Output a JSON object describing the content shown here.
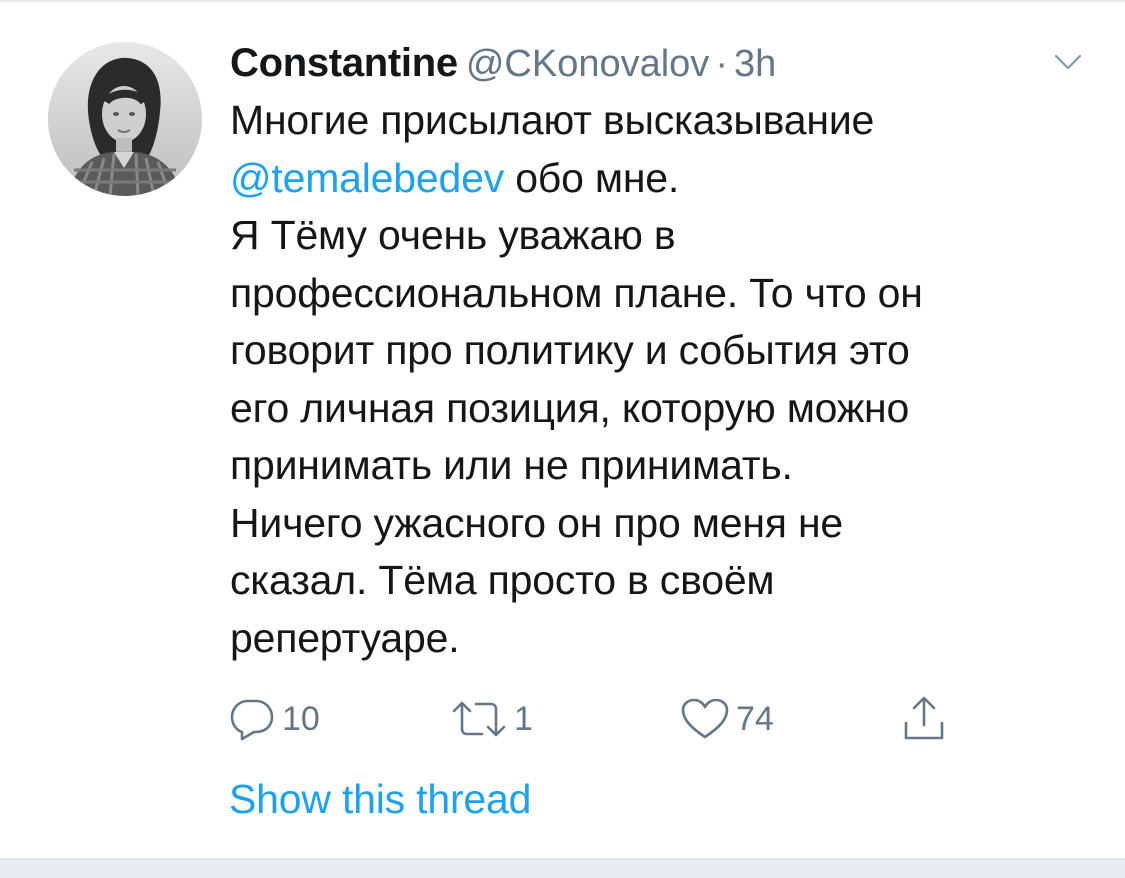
{
  "tweet": {
    "author": {
      "display_name": "Constantine",
      "handle": "@CKonovalov",
      "separator": "·",
      "time": "3h"
    },
    "body": {
      "line1": "Многие присылают высказывание",
      "mention": "@temalebedev",
      "line2_rest": " обо мне.",
      "line3": "Я Тёму очень уважаю в",
      "line4": "профессиональном плане. То что он",
      "line5": "говорит про политику и события это",
      "line6": "его личная позиция, которую можно",
      "line7": "принимать или не принимать.",
      "line8": "Ничего ужасного он про меня не",
      "line9": "сказал. Тёма просто в своём",
      "line10": "репертуаре."
    },
    "actions": {
      "reply_count": "10",
      "retweet_count": "1",
      "like_count": "74"
    },
    "show_thread": "Show this thread"
  },
  "colors": {
    "link": "#1da1f2",
    "muted": "#657786",
    "text": "#14171a",
    "divider": "#e6ecf0"
  },
  "icons": {
    "caret": "chevron-down-icon",
    "reply": "speech-bubble-icon",
    "retweet": "retweet-icon",
    "like": "heart-icon",
    "share": "share-icon"
  }
}
